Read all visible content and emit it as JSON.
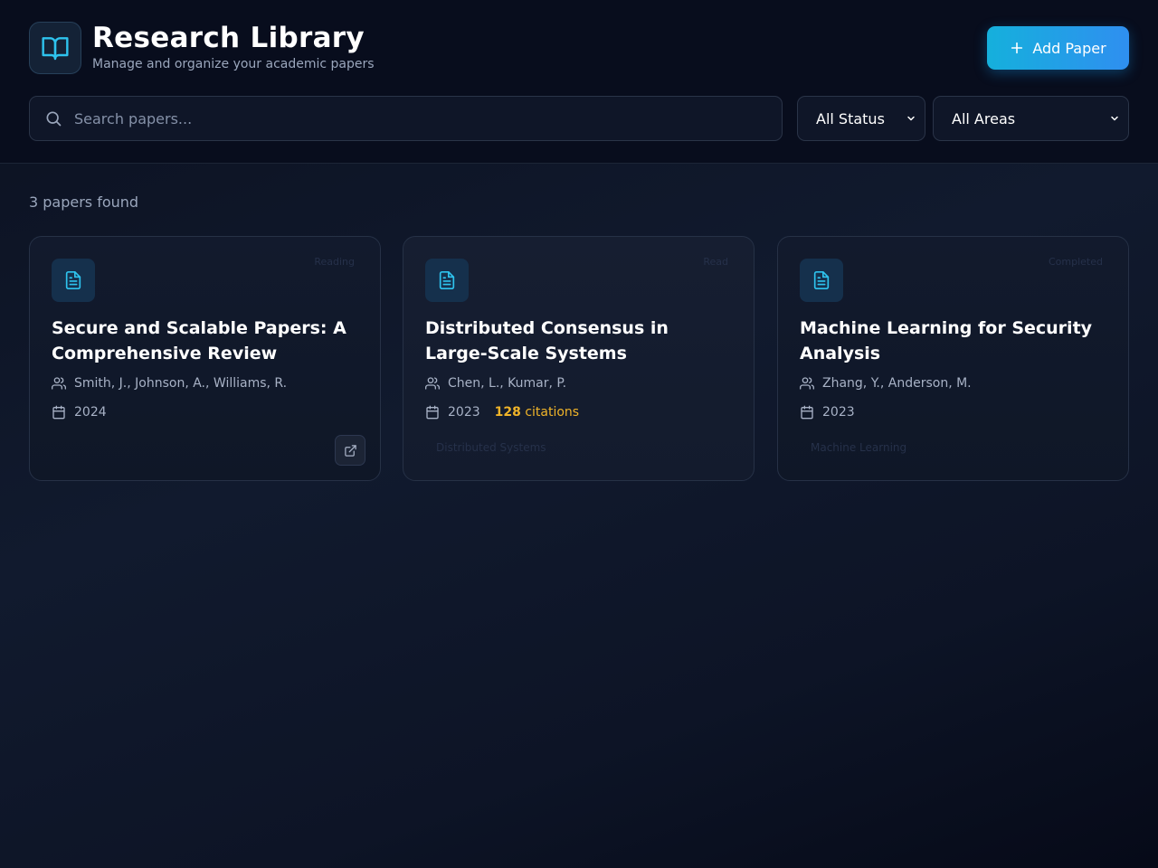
{
  "header": {
    "title": "Research Library",
    "subtitle": "Manage and organize your academic papers",
    "add_button_label": "Add Paper"
  },
  "search": {
    "placeholder": "Search papers...",
    "value": ""
  },
  "filters": {
    "status": "All Status",
    "area": "All Areas"
  },
  "results": {
    "count_text": "3 papers found"
  },
  "papers": [
    {
      "status": "Reading",
      "title": "Secure and Scalable Papers: A Comprehensive Review",
      "authors": "Smith, J., Johnson, A., Williams, R.",
      "year": "2024"
    },
    {
      "status": "Read",
      "title": "Distributed Consensus in Large-Scale Systems",
      "authors": "Chen, L., Kumar, P.",
      "year": "2023",
      "citations_count": "128",
      "citations_label": "citations",
      "area": "Distributed Systems"
    },
    {
      "status": "Completed",
      "title": "Machine Learning for Security Analysis",
      "authors": "Zhang, Y., Anderson, M.",
      "year": "2023",
      "area": "Machine Learning"
    }
  ],
  "colors": {
    "accent": "#22b8e6",
    "citation": "#f0b429",
    "background": "#0b1120"
  },
  "icons": {
    "logo": "book-open-icon",
    "add": "plus-icon",
    "search": "search-icon",
    "paper": "file-text-icon",
    "authors": "users-icon",
    "year": "calendar-icon",
    "open": "external-link-icon"
  }
}
